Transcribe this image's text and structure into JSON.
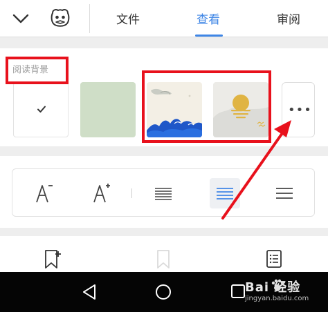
{
  "tabs": [
    {
      "label": "文件",
      "active": false
    },
    {
      "label": "查看",
      "active": true
    },
    {
      "label": "审阅",
      "active": false
    }
  ],
  "reading_background": {
    "label": "阅读背景",
    "swatches": [
      {
        "name": "white",
        "selected": true,
        "color": "#ffffff"
      },
      {
        "name": "green",
        "selected": false,
        "color": "#cfdec7"
      },
      {
        "name": "ink-waves",
        "selected": false
      },
      {
        "name": "golden-sun",
        "selected": false
      }
    ],
    "more_label": "•••"
  },
  "text_tools": [
    "font-size-decrease",
    "font-size-increase",
    "line-spacing-compact",
    "line-spacing-standard",
    "line-spacing-loose"
  ],
  "text_tools_selected": "line-spacing-standard",
  "bottom_icons": [
    "add-bookmark-icon",
    "bookmark-icon",
    "table-of-contents-icon"
  ],
  "nav_bar": [
    "back",
    "home",
    "recents"
  ],
  "watermark": {
    "main": "Bai 经验",
    "sub": "jingyan.baidu.com"
  },
  "colors": {
    "accent": "#3f86e6",
    "annotation": "#e8111c",
    "nav_bg": "#050505"
  }
}
